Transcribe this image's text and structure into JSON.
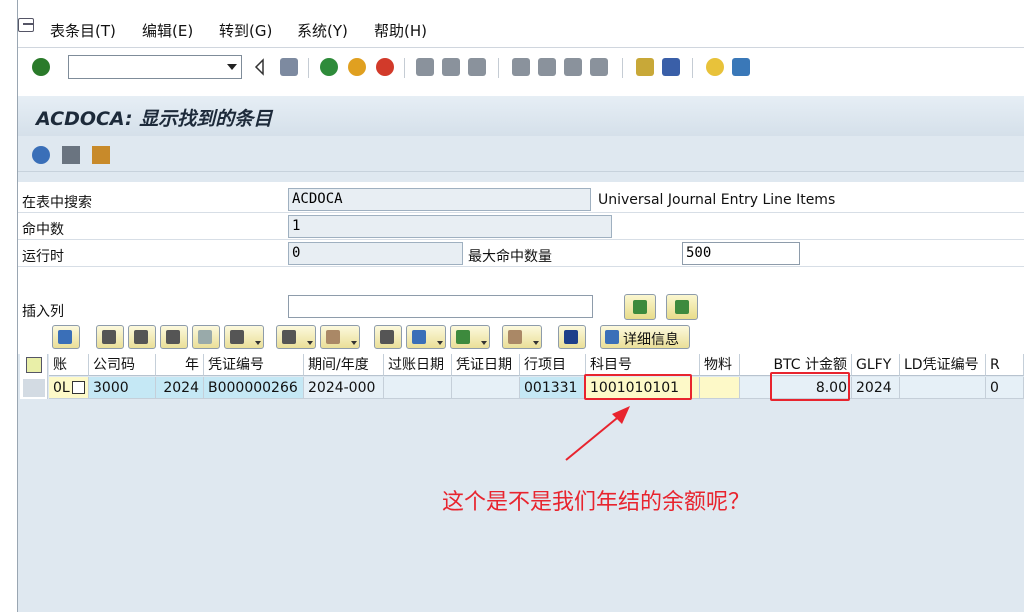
{
  "menu": {
    "items": [
      "表条目(T)",
      "编辑(E)",
      "转到(G)",
      "系统(Y)",
      "帮助(H)"
    ]
  },
  "toolbar": {
    "command_value": ""
  },
  "screen": {
    "title": "ACDOCA: 显示找到的条目"
  },
  "form": {
    "search_table_label": "在表中搜索",
    "search_table_value": "ACDOCA",
    "search_table_desc": "Universal Journal Entry Line Items",
    "hits_label": "命中数",
    "hits_value": "1",
    "runtime_label": "运行时",
    "runtime_value": "0",
    "max_hits_label": "最大命中数量",
    "max_hits_value": "500",
    "insert_col_label": "插入列",
    "insert_col_value": ""
  },
  "alv": {
    "detail_label": "详细信息"
  },
  "table": {
    "headers": [
      "账",
      "公司码",
      "年",
      "凭证编号",
      "期间/年度",
      "过账日期",
      "凭证日期",
      "行项目",
      "科目号",
      "物料",
      "BTC 计金额",
      "GLFY",
      "LD凭证编号",
      "R"
    ],
    "row": [
      "0L",
      "3000",
      "2024",
      "B000000266",
      "2024-000",
      "",
      "",
      "001331",
      "1001010101",
      "",
      "8.00",
      "2024",
      "",
      "0"
    ]
  },
  "annotation": {
    "text": "这个是不是我们年结的余额呢？",
    "color": "#e8242e"
  }
}
